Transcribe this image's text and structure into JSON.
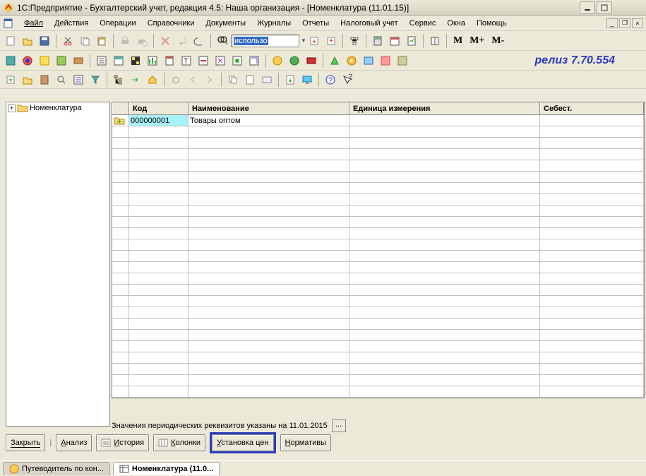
{
  "title": "1С:Предприятие - Бухгалтерский учет, редакция 4.5: Наша организация - [Номенклатура  (11.01.15)]",
  "menu": [
    "Файл",
    "Действия",
    "Операции",
    "Справочники",
    "Документы",
    "Журналы",
    "Отчеты",
    "Налоговый учет",
    "Сервис",
    "Окна",
    "Помощь"
  ],
  "search_text": "использо",
  "release_label": "релиз 7.70.554",
  "calc_buttons": [
    "M",
    "M+",
    "M-"
  ],
  "tree": {
    "root": "Номенклатура"
  },
  "grid": {
    "headers": {
      "code": "Код",
      "name": "Наименование",
      "unit": "Единица измерения",
      "cost": "Себест."
    },
    "rows": [
      {
        "code": "000000001",
        "name": "Товары оптом",
        "unit": "",
        "cost": ""
      }
    ]
  },
  "status_text": "Значения периодических реквизитов указаны на 11.01.2015",
  "buttons": {
    "close": "Закрыть",
    "analysis": "Анализ",
    "history": "История",
    "columns": "Колонки",
    "set_prices": "Установка цен",
    "normatives": "Нормативы"
  },
  "taskbar": {
    "tab1": "Путеводитель по кон...",
    "tab2": "Номенклатура  (11.0..."
  }
}
